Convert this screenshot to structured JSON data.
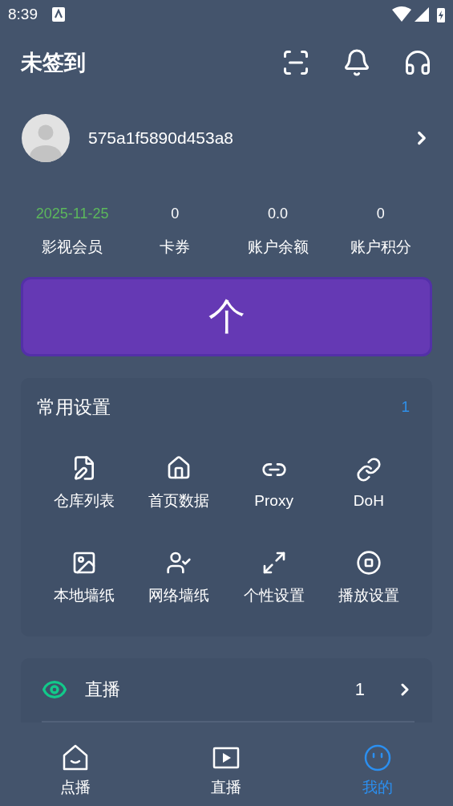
{
  "status_bar": {
    "time": "8:39"
  },
  "header": {
    "title": "未签到"
  },
  "profile": {
    "user_id": "575a1f5890d453a8"
  },
  "stats": [
    {
      "value": "2025-11-25",
      "label": "影视会员",
      "highlight": true
    },
    {
      "value": "0",
      "label": "卡券",
      "highlight": false
    },
    {
      "value": "0.0",
      "label": "账户余额",
      "highlight": false
    },
    {
      "value": "0",
      "label": "账户积分",
      "highlight": false
    }
  ],
  "action_button": {
    "label": "个"
  },
  "common_settings": {
    "title": "常用设置",
    "badge": "1",
    "items": [
      {
        "label": "仓库列表"
      },
      {
        "label": "首页数据"
      },
      {
        "label": "Proxy"
      },
      {
        "label": "DoH"
      },
      {
        "label": "本地墙纸"
      },
      {
        "label": "网络墙纸"
      },
      {
        "label": "个性设置"
      },
      {
        "label": "播放设置"
      }
    ]
  },
  "list": [
    {
      "label": "直播",
      "count": "1"
    }
  ],
  "bottom_nav": [
    {
      "label": "点播",
      "selected": false
    },
    {
      "label": "直播",
      "selected": false
    },
    {
      "label": "我的",
      "selected": true
    }
  ]
}
